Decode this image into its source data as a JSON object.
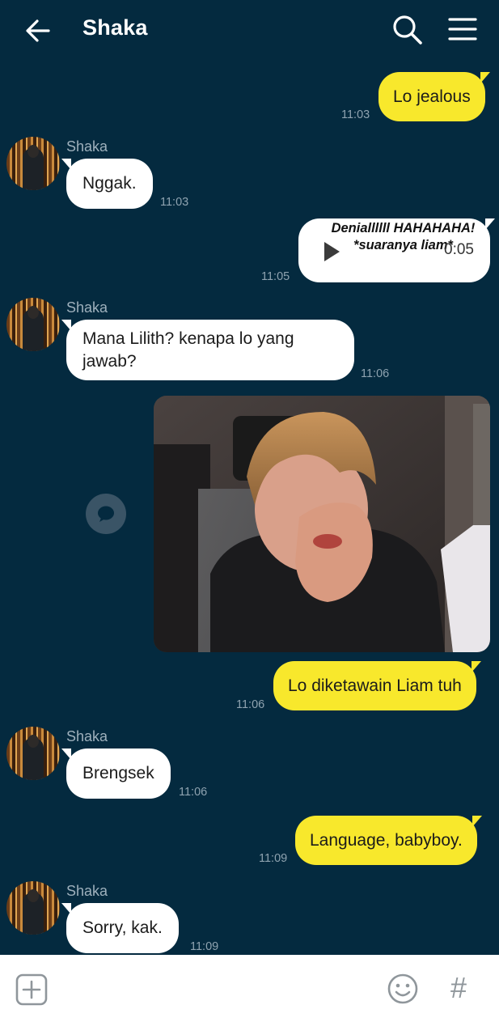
{
  "header": {
    "title": "Shaka",
    "back_icon": "arrow-left-icon",
    "search_icon": "search-icon",
    "menu_icon": "hamburger-menu-icon"
  },
  "messages": [
    {
      "side": "out",
      "text": "Lo jealous",
      "time": "11:03"
    },
    {
      "side": "in",
      "sender": "Shaka",
      "text": "Nggak.",
      "time": "11:03"
    },
    {
      "side": "out",
      "type": "voice",
      "caption": "Deniallllll HAHAHAHA! *suaranya liam*",
      "duration": "0:05",
      "time": "11:05"
    },
    {
      "side": "in",
      "sender": "Shaka",
      "text": "Mana Lilith? kenapa lo yang jawab?",
      "time": "11:06"
    },
    {
      "side": "out",
      "type": "photo",
      "description": "photo-message"
    },
    {
      "side": "out",
      "text": "Lo diketawain Liam tuh",
      "time": "11:06"
    },
    {
      "side": "in",
      "sender": "Shaka",
      "text": "Brengsek",
      "time": "11:06"
    },
    {
      "side": "out",
      "text": "Language, babyboy.",
      "time": "11:09"
    },
    {
      "side": "in",
      "sender": "Shaka",
      "text": "Sorry, kak.",
      "time": "11:09"
    }
  ],
  "bottom_bar": {
    "attach_icon": "plus-square-icon",
    "emoji_icon": "smiley-icon",
    "hashtag_label": "#"
  },
  "colors": {
    "background": "#042a3f",
    "outgoing_bubble": "#f8e82c",
    "incoming_bubble": "#ffffff",
    "timestamp": "#8fa3b0"
  }
}
